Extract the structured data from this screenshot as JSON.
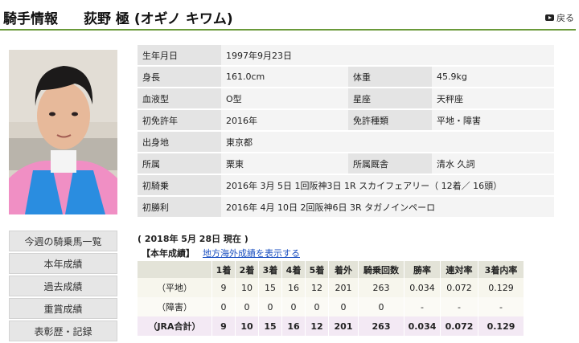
{
  "header": {
    "section_title": "騎手情報",
    "jockey_name": "荻野 極 (オギノ キワム)",
    "back_label": "戻る"
  },
  "photo_icon": "jockey-portrait",
  "colors": {
    "header_rule": "#6a9a3a",
    "link": "#1a4fc0",
    "jra_total_row": "#f3e9f4"
  },
  "profile": {
    "birth_label": "生年月日",
    "birth_value": "1997年9月23日",
    "height_label": "身長",
    "height_value": "161.0cm",
    "weight_label": "体重",
    "weight_value": "45.9kg",
    "blood_label": "血液型",
    "blood_value": "O型",
    "star_label": "星座",
    "star_value": "天秤座",
    "license_year_label": "初免許年",
    "license_year_value": "2016年",
    "license_type_label": "免許種類",
    "license_type_value": "平地・障害",
    "birthplace_label": "出身地",
    "birthplace_value": "東京都",
    "affil_label": "所属",
    "affil_value": "栗東",
    "stable_label": "所属厩舎",
    "stable_value": "清水 久詞",
    "first_ride_label": "初騎乗",
    "first_ride_value": "2016年 3月 5日 1回阪神3日 1R スカイフェアリー（ 12着／ 16頭）",
    "first_win_label": "初勝利",
    "first_win_value": "2016年 4月 10日 2回阪神6日 3R タガノインペーロ"
  },
  "menu": {
    "items": [
      "今週の騎乗馬一覧",
      "本年成績",
      "過去成績",
      "重賞成績",
      "表彰歴・記録"
    ]
  },
  "stats": {
    "as_of": "( 2018年 5月 28日 現在 )",
    "section_label": "【本年成績】",
    "overseas_link": "地方海外成績を表示する",
    "headers": [
      "",
      "1着",
      "2着",
      "3着",
      "4着",
      "5着",
      "着外",
      "騎乗回数",
      "勝率",
      "連対率",
      "3着内率"
    ],
    "rows": [
      [
        "（平地）",
        "9",
        "10",
        "15",
        "16",
        "12",
        "201",
        "263",
        "0.034",
        "0.072",
        "0.129"
      ],
      [
        "（障害）",
        "0",
        "0",
        "0",
        "0",
        "0",
        "0",
        "0",
        "-",
        "-",
        "-"
      ],
      [
        "（JRA合計）",
        "9",
        "10",
        "15",
        "16",
        "12",
        "201",
        "263",
        "0.034",
        "0.072",
        "0.129"
      ]
    ]
  }
}
